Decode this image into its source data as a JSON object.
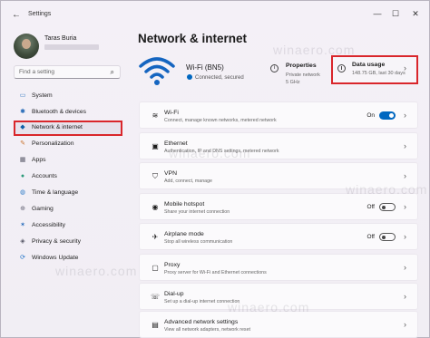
{
  "titlebar": {
    "back_icon": "back-arrow-icon",
    "app_title": "Settings",
    "minimize": "—",
    "maximize": "☐",
    "close": "✕"
  },
  "user": {
    "name": "Taras Buria"
  },
  "search": {
    "placeholder": "Find a setting"
  },
  "sidebar": {
    "items": [
      {
        "label": "System",
        "icon": "monitor-icon",
        "glyph": "▭",
        "color": "#3b7fc4"
      },
      {
        "label": "Bluetooth & devices",
        "icon": "bluetooth-icon",
        "glyph": "✱",
        "color": "#1b64b4"
      },
      {
        "label": "Network & internet",
        "icon": "wifi-icon",
        "glyph": "◆",
        "color": "#0e5fa8",
        "active": true
      },
      {
        "label": "Personalization",
        "icon": "brush-icon",
        "glyph": "✎",
        "color": "#c9722d"
      },
      {
        "label": "Apps",
        "icon": "apps-icon",
        "glyph": "▦",
        "color": "#5a5a6a"
      },
      {
        "label": "Accounts",
        "icon": "person-icon",
        "glyph": "●",
        "color": "#2b9a7a"
      },
      {
        "label": "Time & language",
        "icon": "globe-icon",
        "glyph": "◍",
        "color": "#2f7cc7"
      },
      {
        "label": "Gaming",
        "icon": "gamepad-icon",
        "glyph": "⊕",
        "color": "#6a6a7a"
      },
      {
        "label": "Accessibility",
        "icon": "accessibility-icon",
        "glyph": "✶",
        "color": "#1e66b8"
      },
      {
        "label": "Privacy & security",
        "icon": "shield-icon",
        "glyph": "◈",
        "color": "#5a5a6a"
      },
      {
        "label": "Windows Update",
        "icon": "update-icon",
        "glyph": "⟳",
        "color": "#1c6fc6"
      }
    ]
  },
  "page": {
    "title": "Network & internet"
  },
  "hero": {
    "network_name": "Wi-Fi (BN5)",
    "status": "Connected, secured",
    "properties_title": "Properties",
    "properties_sub1": "Private network",
    "properties_sub2": "5 GHz",
    "data_usage_title": "Data usage",
    "data_usage_sub": "148.75 GB, last 30 days"
  },
  "rows": [
    {
      "title": "Wi-Fi",
      "sub": "Connect, manage known networks, metered network",
      "icon": "wifi-icon",
      "glyph": "≋",
      "state": "On",
      "toggle": "on"
    },
    {
      "title": "Ethernet",
      "sub": "Authentication, IP and DNS settings, metered network",
      "icon": "ethernet-icon",
      "glyph": "▣",
      "chevron": true
    },
    {
      "title": "VPN",
      "sub": "Add, connect, manage",
      "icon": "vpn-shield-icon",
      "glyph": "⛉",
      "chevron": true
    },
    {
      "title": "Mobile hotspot",
      "sub": "Share your internet connection",
      "icon": "hotspot-icon",
      "glyph": "◉",
      "state": "Off",
      "toggle": "off"
    },
    {
      "title": "Airplane mode",
      "sub": "Stop all wireless communication",
      "icon": "airplane-icon",
      "glyph": "✈",
      "state": "Off",
      "toggle": "off"
    },
    {
      "title": "Proxy",
      "sub": "Proxy server for Wi-Fi and Ethernet connections",
      "icon": "proxy-icon",
      "glyph": "▢",
      "chevron": true
    },
    {
      "title": "Dial-up",
      "sub": "Set up a dial-up internet connection",
      "icon": "dialup-icon",
      "glyph": "☏",
      "chevron": true
    },
    {
      "title": "Advanced network settings",
      "sub": "View all network adapters, network reset",
      "icon": "network-adapter-icon",
      "glyph": "▤",
      "chevron": true
    }
  ],
  "chevron": "›",
  "watermark": "winaero.com",
  "colors": {
    "accent": "#0067c0",
    "highlight": "#d9262b"
  }
}
